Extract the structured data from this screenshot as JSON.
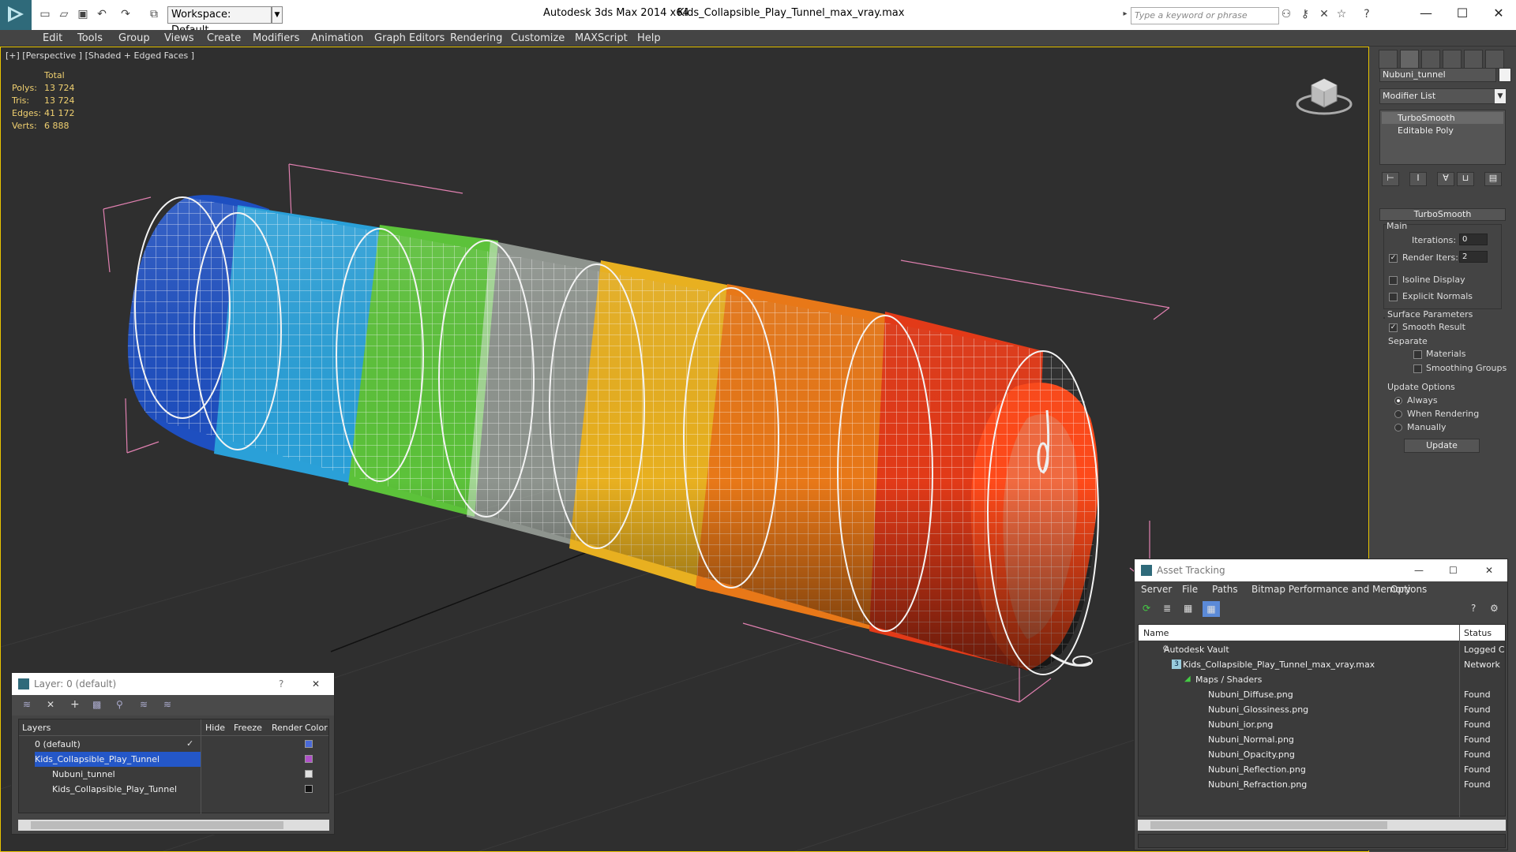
{
  "titlebar": {
    "workspace_label": "Workspace: Default",
    "app_title": "Autodesk 3ds Max  2014 x64",
    "document_name": "Kids_Collapsible_Play_Tunnel_max_vray.max",
    "search_placeholder": "Type a keyword or phrase",
    "minimize": "—",
    "maximize": "☐",
    "close": "✕"
  },
  "menu": [
    "Edit",
    "Tools",
    "Group",
    "Views",
    "Create",
    "Modifiers",
    "Animation",
    "Graph Editors",
    "Rendering",
    "Customize",
    "MAXScript",
    "Help"
  ],
  "viewport": {
    "label": "[+] [Perspective ] [Shaded + Edged Faces ]",
    "stats": {
      "header": "Total",
      "rows": [
        {
          "label": "Polys:",
          "value": "13 724"
        },
        {
          "label": "Tris:",
          "value": "13 724"
        },
        {
          "label": "Edges:",
          "value": "41 172"
        },
        {
          "label": "Verts:",
          "value": "6 888"
        }
      ]
    },
    "tunnel_colors": [
      "#1e4fc0",
      "#2aa0d8",
      "#5cc23a",
      "#ffffff",
      "#e8b020",
      "#e87818",
      "#e23a18"
    ]
  },
  "command_panel": {
    "object_name": "Nubuni_tunnel",
    "modifier_list": "Modifier List",
    "stack": [
      "TurboSmooth",
      "Editable Poly"
    ],
    "turbosmooth": {
      "title": "TurboSmooth",
      "main_label": "Main",
      "iterations_label": "Iterations:",
      "iterations_value": "0",
      "render_iters_label": "Render Iters:",
      "render_iters_value": "2",
      "render_iters_checked": true,
      "isoline_label": "Isoline Display",
      "explicit_normals_label": "Explicit Normals",
      "surface_params_label": "Surface Parameters",
      "smooth_result_label": "Smooth Result",
      "separate_label": "Separate",
      "materials_label": "Materials",
      "smoothing_groups_label": "Smoothing Groups",
      "update_options_label": "Update Options",
      "always_label": "Always",
      "when_rendering_label": "When Rendering",
      "manually_label": "Manually",
      "update_button": "Update"
    }
  },
  "layer_panel": {
    "title": "Layer: 0 (default)",
    "help": "?",
    "close": "✕",
    "columns": [
      "Layers",
      "Hide",
      "Freeze",
      "Render",
      "Color"
    ],
    "rows": [
      {
        "name": "0 (default)",
        "color": "#4a6ad8"
      },
      {
        "name": "Kids_Collapsible_Play_Tunnel",
        "color": "#b050c8"
      },
      {
        "name": "Nubuni_tunnel",
        "color": "#e0e0e0"
      },
      {
        "name": "Kids_Collapsible_Play_Tunnel",
        "color": "#111111"
      }
    ]
  },
  "asset_panel": {
    "title": "Asset Tracking",
    "menu": [
      "Server",
      "File",
      "Paths",
      "Bitmap Performance and Memory",
      "Options"
    ],
    "columns": [
      "Name",
      "Status"
    ],
    "rows": [
      {
        "name": "Autodesk Vault",
        "status": "Logged C"
      },
      {
        "name": "Kids_Collapsible_Play_Tunnel_max_vray.max",
        "status": "Network"
      },
      {
        "name": "Maps / Shaders",
        "status": ""
      },
      {
        "name": "Nubuni_Diffuse.png",
        "status": "Found"
      },
      {
        "name": "Nubuni_Glossiness.png",
        "status": "Found"
      },
      {
        "name": "Nubuni_ior.png",
        "status": "Found"
      },
      {
        "name": "Nubuni_Normal.png",
        "status": "Found"
      },
      {
        "name": "Nubuni_Opacity.png",
        "status": "Found"
      },
      {
        "name": "Nubuni_Reflection.png",
        "status": "Found"
      },
      {
        "name": "Nubuni_Refraction.png",
        "status": "Found"
      }
    ]
  }
}
